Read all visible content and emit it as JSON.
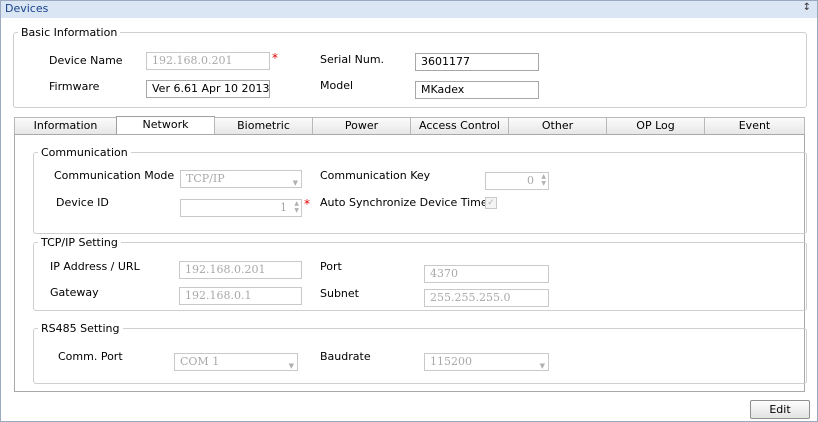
{
  "window": {
    "title": "Devices",
    "pin_icon": "pin-icon"
  },
  "basic_info": {
    "legend": "Basic Information",
    "device_name_label": "Device Name",
    "device_name_value": "192.168.0.201",
    "serial_label": "Serial Num.",
    "serial_value": "3601177",
    "firmware_label": "Firmware",
    "firmware_value": "Ver 6.61 Apr 10 2013",
    "model_label": "Model",
    "model_value": "MKadex",
    "required_mark": "*"
  },
  "tabs": [
    "Information",
    "Network",
    "Biometric",
    "Power",
    "Access Control",
    "Other",
    "OP Log",
    "Event"
  ],
  "active_tab": "Network",
  "communication": {
    "legend": "Communication",
    "mode_label": "Communication Mode",
    "mode_value": "TCP/IP",
    "key_label": "Communication Key",
    "key_value": "0",
    "device_id_label": "Device ID",
    "device_id_value": "1",
    "auto_sync_label": "Auto Synchronize Device Time",
    "auto_sync_checked": true,
    "required_mark": "*"
  },
  "tcpip": {
    "legend": "TCP/IP Setting",
    "ip_label": "IP Address / URL",
    "ip_value": "192.168.0.201",
    "port_label": "Port",
    "port_value": "4370",
    "gateway_label": "Gateway",
    "gateway_value": "192.168.0.1",
    "subnet_label": "Subnet",
    "subnet_value": "255.255.255.0"
  },
  "rs485": {
    "legend": "RS485 Setting",
    "comm_port_label": "Comm. Port",
    "comm_port_value": "COM 1",
    "baudrate_label": "Baudrate",
    "baudrate_value": "115200"
  },
  "footer": {
    "edit_label": "Edit"
  }
}
